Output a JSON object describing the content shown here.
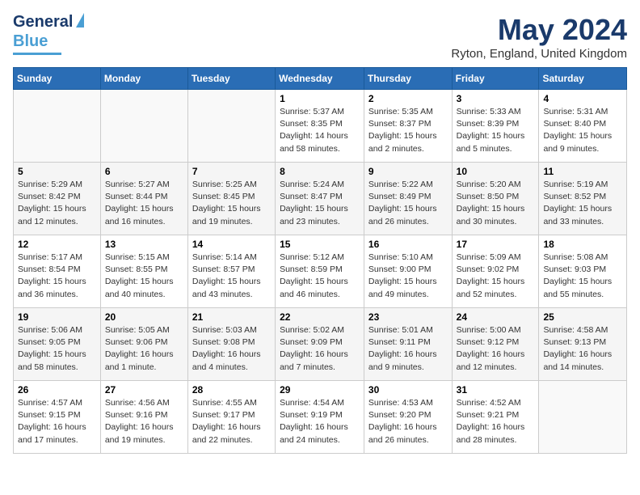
{
  "header": {
    "logo_general": "General",
    "logo_blue": "Blue",
    "month": "May 2024",
    "location": "Ryton, England, United Kingdom"
  },
  "days_of_week": [
    "Sunday",
    "Monday",
    "Tuesday",
    "Wednesday",
    "Thursday",
    "Friday",
    "Saturday"
  ],
  "weeks": [
    [
      {
        "day": "",
        "info": ""
      },
      {
        "day": "",
        "info": ""
      },
      {
        "day": "",
        "info": ""
      },
      {
        "day": "1",
        "info": "Sunrise: 5:37 AM\nSunset: 8:35 PM\nDaylight: 14 hours\nand 58 minutes."
      },
      {
        "day": "2",
        "info": "Sunrise: 5:35 AM\nSunset: 8:37 PM\nDaylight: 15 hours\nand 2 minutes."
      },
      {
        "day": "3",
        "info": "Sunrise: 5:33 AM\nSunset: 8:39 PM\nDaylight: 15 hours\nand 5 minutes."
      },
      {
        "day": "4",
        "info": "Sunrise: 5:31 AM\nSunset: 8:40 PM\nDaylight: 15 hours\nand 9 minutes."
      }
    ],
    [
      {
        "day": "5",
        "info": "Sunrise: 5:29 AM\nSunset: 8:42 PM\nDaylight: 15 hours\nand 12 minutes."
      },
      {
        "day": "6",
        "info": "Sunrise: 5:27 AM\nSunset: 8:44 PM\nDaylight: 15 hours\nand 16 minutes."
      },
      {
        "day": "7",
        "info": "Sunrise: 5:25 AM\nSunset: 8:45 PM\nDaylight: 15 hours\nand 19 minutes."
      },
      {
        "day": "8",
        "info": "Sunrise: 5:24 AM\nSunset: 8:47 PM\nDaylight: 15 hours\nand 23 minutes."
      },
      {
        "day": "9",
        "info": "Sunrise: 5:22 AM\nSunset: 8:49 PM\nDaylight: 15 hours\nand 26 minutes."
      },
      {
        "day": "10",
        "info": "Sunrise: 5:20 AM\nSunset: 8:50 PM\nDaylight: 15 hours\nand 30 minutes."
      },
      {
        "day": "11",
        "info": "Sunrise: 5:19 AM\nSunset: 8:52 PM\nDaylight: 15 hours\nand 33 minutes."
      }
    ],
    [
      {
        "day": "12",
        "info": "Sunrise: 5:17 AM\nSunset: 8:54 PM\nDaylight: 15 hours\nand 36 minutes."
      },
      {
        "day": "13",
        "info": "Sunrise: 5:15 AM\nSunset: 8:55 PM\nDaylight: 15 hours\nand 40 minutes."
      },
      {
        "day": "14",
        "info": "Sunrise: 5:14 AM\nSunset: 8:57 PM\nDaylight: 15 hours\nand 43 minutes."
      },
      {
        "day": "15",
        "info": "Sunrise: 5:12 AM\nSunset: 8:59 PM\nDaylight: 15 hours\nand 46 minutes."
      },
      {
        "day": "16",
        "info": "Sunrise: 5:10 AM\nSunset: 9:00 PM\nDaylight: 15 hours\nand 49 minutes."
      },
      {
        "day": "17",
        "info": "Sunrise: 5:09 AM\nSunset: 9:02 PM\nDaylight: 15 hours\nand 52 minutes."
      },
      {
        "day": "18",
        "info": "Sunrise: 5:08 AM\nSunset: 9:03 PM\nDaylight: 15 hours\nand 55 minutes."
      }
    ],
    [
      {
        "day": "19",
        "info": "Sunrise: 5:06 AM\nSunset: 9:05 PM\nDaylight: 15 hours\nand 58 minutes."
      },
      {
        "day": "20",
        "info": "Sunrise: 5:05 AM\nSunset: 9:06 PM\nDaylight: 16 hours\nand 1 minute."
      },
      {
        "day": "21",
        "info": "Sunrise: 5:03 AM\nSunset: 9:08 PM\nDaylight: 16 hours\nand 4 minutes."
      },
      {
        "day": "22",
        "info": "Sunrise: 5:02 AM\nSunset: 9:09 PM\nDaylight: 16 hours\nand 7 minutes."
      },
      {
        "day": "23",
        "info": "Sunrise: 5:01 AM\nSunset: 9:11 PM\nDaylight: 16 hours\nand 9 minutes."
      },
      {
        "day": "24",
        "info": "Sunrise: 5:00 AM\nSunset: 9:12 PM\nDaylight: 16 hours\nand 12 minutes."
      },
      {
        "day": "25",
        "info": "Sunrise: 4:58 AM\nSunset: 9:13 PM\nDaylight: 16 hours\nand 14 minutes."
      }
    ],
    [
      {
        "day": "26",
        "info": "Sunrise: 4:57 AM\nSunset: 9:15 PM\nDaylight: 16 hours\nand 17 minutes."
      },
      {
        "day": "27",
        "info": "Sunrise: 4:56 AM\nSunset: 9:16 PM\nDaylight: 16 hours\nand 19 minutes."
      },
      {
        "day": "28",
        "info": "Sunrise: 4:55 AM\nSunset: 9:17 PM\nDaylight: 16 hours\nand 22 minutes."
      },
      {
        "day": "29",
        "info": "Sunrise: 4:54 AM\nSunset: 9:19 PM\nDaylight: 16 hours\nand 24 minutes."
      },
      {
        "day": "30",
        "info": "Sunrise: 4:53 AM\nSunset: 9:20 PM\nDaylight: 16 hours\nand 26 minutes."
      },
      {
        "day": "31",
        "info": "Sunrise: 4:52 AM\nSunset: 9:21 PM\nDaylight: 16 hours\nand 28 minutes."
      },
      {
        "day": "",
        "info": ""
      }
    ]
  ]
}
